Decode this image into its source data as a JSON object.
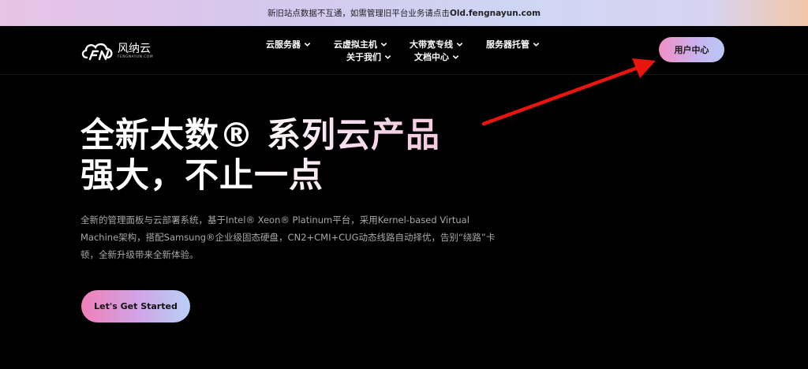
{
  "banner": {
    "text": "新旧站点数据不互通，如需管理旧平台业务请点击",
    "link": "Old.fengnayun.com"
  },
  "logo": {
    "name": "风纳云",
    "subtext": "FENGNAYUN.COM"
  },
  "nav": {
    "items": [
      {
        "label": "云服务器"
      },
      {
        "label": "云虚拟主机"
      },
      {
        "label": "大带宽专线"
      },
      {
        "label": "服务器托管"
      },
      {
        "label": "关于我们"
      },
      {
        "label": "文档中心"
      }
    ],
    "user_center": "用户中心"
  },
  "hero": {
    "title_line1": "全新太数® 系列云产品",
    "title_line2": "强大，不止一点",
    "description": "全新的管理面板与云部署系统，基于Intel® Xeon® Platinum平台，采用Kernel-based Virtual Machine架构，搭配Samsung®企业级固态硬盘，CN2+CMI+CUG动态线路自动择优，告别“绕路”卡顿，全新升级带来全新体验。",
    "cta": "Let's Get Started"
  },
  "colors": {
    "annotation_arrow": "#e8150e",
    "background": "#000000"
  }
}
